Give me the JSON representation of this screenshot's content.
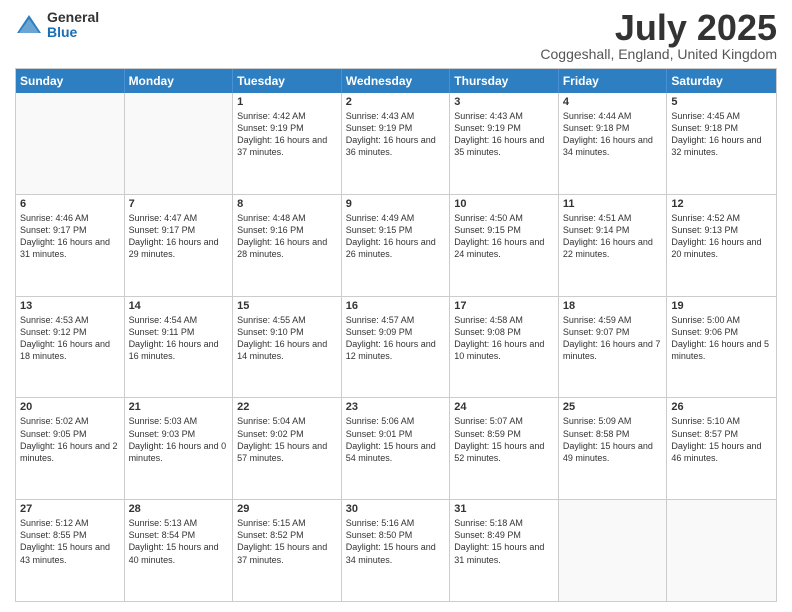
{
  "logo": {
    "general": "General",
    "blue": "Blue"
  },
  "title": "July 2025",
  "location": "Coggeshall, England, United Kingdom",
  "headers": [
    "Sunday",
    "Monday",
    "Tuesday",
    "Wednesday",
    "Thursday",
    "Friday",
    "Saturday"
  ],
  "weeks": [
    [
      {
        "day": "",
        "text": ""
      },
      {
        "day": "",
        "text": ""
      },
      {
        "day": "1",
        "text": "Sunrise: 4:42 AM\nSunset: 9:19 PM\nDaylight: 16 hours and 37 minutes."
      },
      {
        "day": "2",
        "text": "Sunrise: 4:43 AM\nSunset: 9:19 PM\nDaylight: 16 hours and 36 minutes."
      },
      {
        "day": "3",
        "text": "Sunrise: 4:43 AM\nSunset: 9:19 PM\nDaylight: 16 hours and 35 minutes."
      },
      {
        "day": "4",
        "text": "Sunrise: 4:44 AM\nSunset: 9:18 PM\nDaylight: 16 hours and 34 minutes."
      },
      {
        "day": "5",
        "text": "Sunrise: 4:45 AM\nSunset: 9:18 PM\nDaylight: 16 hours and 32 minutes."
      }
    ],
    [
      {
        "day": "6",
        "text": "Sunrise: 4:46 AM\nSunset: 9:17 PM\nDaylight: 16 hours and 31 minutes."
      },
      {
        "day": "7",
        "text": "Sunrise: 4:47 AM\nSunset: 9:17 PM\nDaylight: 16 hours and 29 minutes."
      },
      {
        "day": "8",
        "text": "Sunrise: 4:48 AM\nSunset: 9:16 PM\nDaylight: 16 hours and 28 minutes."
      },
      {
        "day": "9",
        "text": "Sunrise: 4:49 AM\nSunset: 9:15 PM\nDaylight: 16 hours and 26 minutes."
      },
      {
        "day": "10",
        "text": "Sunrise: 4:50 AM\nSunset: 9:15 PM\nDaylight: 16 hours and 24 minutes."
      },
      {
        "day": "11",
        "text": "Sunrise: 4:51 AM\nSunset: 9:14 PM\nDaylight: 16 hours and 22 minutes."
      },
      {
        "day": "12",
        "text": "Sunrise: 4:52 AM\nSunset: 9:13 PM\nDaylight: 16 hours and 20 minutes."
      }
    ],
    [
      {
        "day": "13",
        "text": "Sunrise: 4:53 AM\nSunset: 9:12 PM\nDaylight: 16 hours and 18 minutes."
      },
      {
        "day": "14",
        "text": "Sunrise: 4:54 AM\nSunset: 9:11 PM\nDaylight: 16 hours and 16 minutes."
      },
      {
        "day": "15",
        "text": "Sunrise: 4:55 AM\nSunset: 9:10 PM\nDaylight: 16 hours and 14 minutes."
      },
      {
        "day": "16",
        "text": "Sunrise: 4:57 AM\nSunset: 9:09 PM\nDaylight: 16 hours and 12 minutes."
      },
      {
        "day": "17",
        "text": "Sunrise: 4:58 AM\nSunset: 9:08 PM\nDaylight: 16 hours and 10 minutes."
      },
      {
        "day": "18",
        "text": "Sunrise: 4:59 AM\nSunset: 9:07 PM\nDaylight: 16 hours and 7 minutes."
      },
      {
        "day": "19",
        "text": "Sunrise: 5:00 AM\nSunset: 9:06 PM\nDaylight: 16 hours and 5 minutes."
      }
    ],
    [
      {
        "day": "20",
        "text": "Sunrise: 5:02 AM\nSunset: 9:05 PM\nDaylight: 16 hours and 2 minutes."
      },
      {
        "day": "21",
        "text": "Sunrise: 5:03 AM\nSunset: 9:03 PM\nDaylight: 16 hours and 0 minutes."
      },
      {
        "day": "22",
        "text": "Sunrise: 5:04 AM\nSunset: 9:02 PM\nDaylight: 15 hours and 57 minutes."
      },
      {
        "day": "23",
        "text": "Sunrise: 5:06 AM\nSunset: 9:01 PM\nDaylight: 15 hours and 54 minutes."
      },
      {
        "day": "24",
        "text": "Sunrise: 5:07 AM\nSunset: 8:59 PM\nDaylight: 15 hours and 52 minutes."
      },
      {
        "day": "25",
        "text": "Sunrise: 5:09 AM\nSunset: 8:58 PM\nDaylight: 15 hours and 49 minutes."
      },
      {
        "day": "26",
        "text": "Sunrise: 5:10 AM\nSunset: 8:57 PM\nDaylight: 15 hours and 46 minutes."
      }
    ],
    [
      {
        "day": "27",
        "text": "Sunrise: 5:12 AM\nSunset: 8:55 PM\nDaylight: 15 hours and 43 minutes."
      },
      {
        "day": "28",
        "text": "Sunrise: 5:13 AM\nSunset: 8:54 PM\nDaylight: 15 hours and 40 minutes."
      },
      {
        "day": "29",
        "text": "Sunrise: 5:15 AM\nSunset: 8:52 PM\nDaylight: 15 hours and 37 minutes."
      },
      {
        "day": "30",
        "text": "Sunrise: 5:16 AM\nSunset: 8:50 PM\nDaylight: 15 hours and 34 minutes."
      },
      {
        "day": "31",
        "text": "Sunrise: 5:18 AM\nSunset: 8:49 PM\nDaylight: 15 hours and 31 minutes."
      },
      {
        "day": "",
        "text": ""
      },
      {
        "day": "",
        "text": ""
      }
    ]
  ]
}
